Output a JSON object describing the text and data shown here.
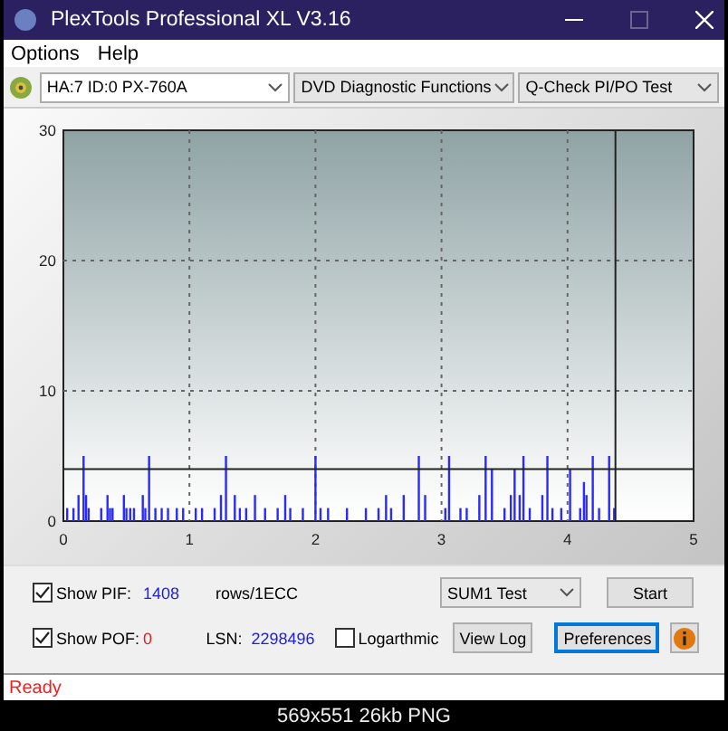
{
  "window": {
    "title": "PlexTools Professional XL V3.16"
  },
  "menu": [
    "Options",
    "Help"
  ],
  "toolbar": {
    "drive": "HA:7 ID:0  PX-760A",
    "function": "DVD Diagnostic Functions",
    "test": "Q-Check PI/PO Test"
  },
  "chart_data": {
    "type": "bar",
    "xlim": [
      0,
      5
    ],
    "ylim": [
      0,
      30
    ],
    "xticks": [
      0,
      1,
      2,
      3,
      4,
      5
    ],
    "yticks": [
      0,
      10,
      20,
      30
    ],
    "grid": true,
    "series": [
      {
        "color": "#2a2aff",
        "x": [
          0.03,
          0.08,
          0.12,
          0.16,
          0.18,
          0.2,
          0.3,
          0.35,
          0.37,
          0.39,
          0.48,
          0.5,
          0.53,
          0.56,
          0.63,
          0.65,
          0.68,
          0.73,
          0.78,
          0.83,
          0.9,
          0.95,
          1.05,
          1.1,
          1.2,
          1.25,
          1.29,
          1.36,
          1.4,
          1.45,
          1.52,
          1.6,
          1.7,
          1.76,
          1.8,
          1.9,
          2.0,
          2.04,
          2.1,
          2.25,
          2.4,
          2.5,
          2.56,
          2.6,
          2.7,
          2.82,
          2.87,
          3.03,
          3.06,
          3.15,
          3.2,
          3.3,
          3.35,
          3.4,
          3.5,
          3.55,
          3.58,
          3.62,
          3.65,
          3.7,
          3.8,
          3.84,
          3.88,
          3.95,
          4.02,
          4.1,
          4.13,
          4.15,
          4.2,
          4.25,
          4.33,
          4.37
        ],
        "values": [
          1,
          1,
          2,
          5,
          2,
          1,
          1,
          2,
          1,
          1,
          2,
          1,
          1,
          1,
          2,
          1,
          5,
          1,
          1,
          1,
          1,
          1,
          1,
          1,
          1,
          2,
          5,
          2,
          1,
          1,
          2,
          1,
          1,
          2,
          1,
          1,
          5,
          1,
          1,
          1,
          1,
          1,
          2,
          1,
          2,
          5,
          2,
          1,
          5,
          1,
          1,
          2,
          5,
          4,
          1,
          2,
          4,
          2,
          5,
          1,
          2,
          5,
          1,
          1,
          4,
          1,
          3,
          2,
          5,
          1,
          5,
          1
        ]
      }
    ],
    "ref_lines": [
      {
        "axis": "y",
        "value": 4
      },
      {
        "axis": "x",
        "value": 4.38
      }
    ]
  },
  "controls": {
    "show_pif": {
      "label": "Show PIF:",
      "checked": true,
      "value": "1408",
      "unit": "rows/1ECC"
    },
    "show_pof": {
      "label": "Show POF:",
      "checked": true,
      "value": "0"
    },
    "lsn": {
      "label": "LSN:",
      "value": "2298496"
    },
    "logarithmic": {
      "label": "Logarthmic",
      "checked": false
    },
    "sum_test": "SUM1 Test",
    "buttons": [
      "Start",
      "View Log",
      "Preferences"
    ]
  },
  "status_bar": "Ready",
  "image_caption": "569x551 26kb PNG"
}
